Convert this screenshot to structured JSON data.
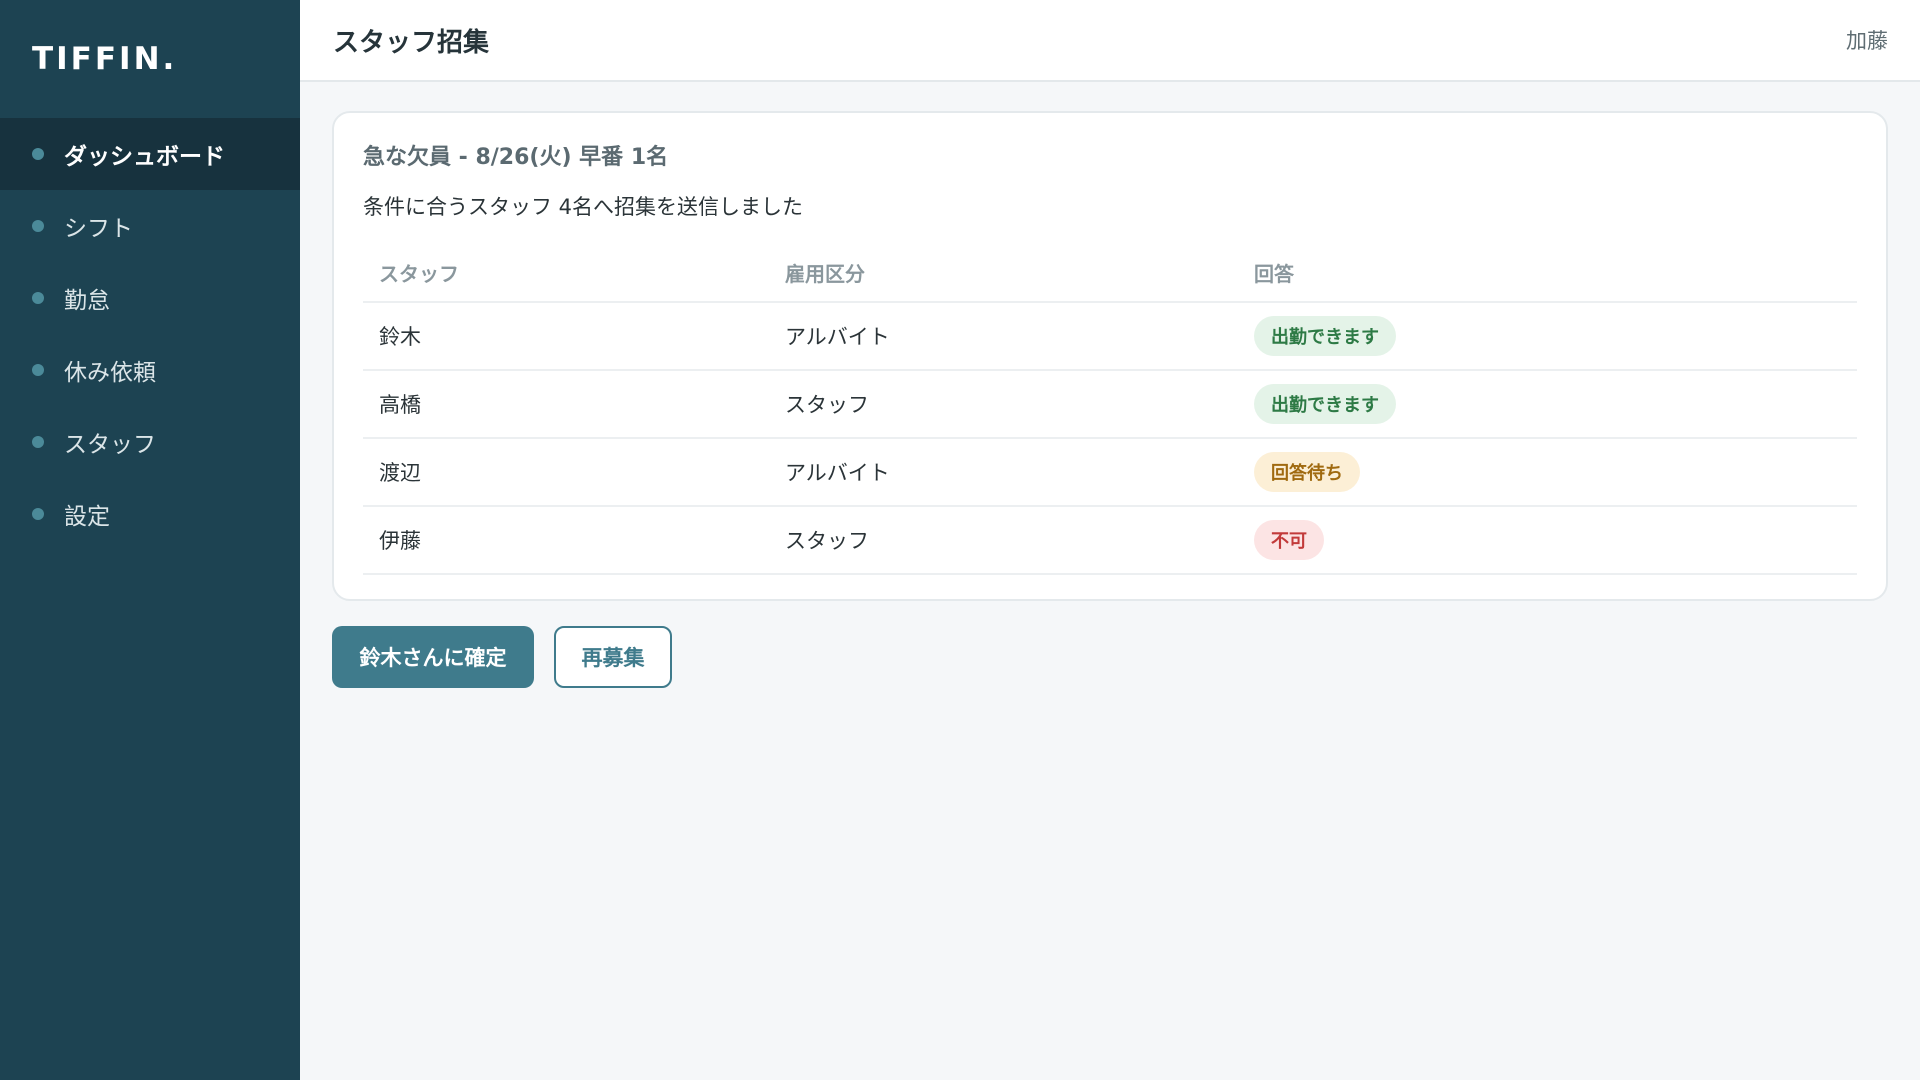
{
  "sidebar": {
    "logo": "TIFFIN.",
    "items": [
      {
        "label": "ダッシュボード",
        "active": true
      },
      {
        "label": "シフト",
        "active": false
      },
      {
        "label": "勤怠",
        "active": false
      },
      {
        "label": "休み依頼",
        "active": false
      },
      {
        "label": "スタッフ",
        "active": false
      },
      {
        "label": "設定",
        "active": false
      }
    ]
  },
  "header": {
    "title": "スタッフ招集",
    "user": "加藤"
  },
  "card": {
    "title": "急な欠員 - 8/26(火) 早番 1名",
    "description": "条件に合うスタッフ 4名へ招集を送信しました",
    "columns": [
      "スタッフ",
      "雇用区分",
      "回答"
    ],
    "rows": [
      {
        "name": "鈴木",
        "type": "アルバイト",
        "status": "出勤できます",
        "status_kind": "ok"
      },
      {
        "name": "高橋",
        "type": "スタッフ",
        "status": "出勤できます",
        "status_kind": "ok"
      },
      {
        "name": "渡辺",
        "type": "アルバイト",
        "status": "回答待ち",
        "status_kind": "wait"
      },
      {
        "name": "伊藤",
        "type": "スタッフ",
        "status": "不可",
        "status_kind": "no"
      }
    ]
  },
  "actions": {
    "confirm_label": "鈴木さんに確定",
    "recruit_label": "再募集"
  },
  "colors": {
    "sidebar_bg": "#1d4352",
    "accent": "#3f7b8c",
    "status_ok": "#2d7a45",
    "status_wait": "#a06a10",
    "status_no": "#c23a3a"
  }
}
